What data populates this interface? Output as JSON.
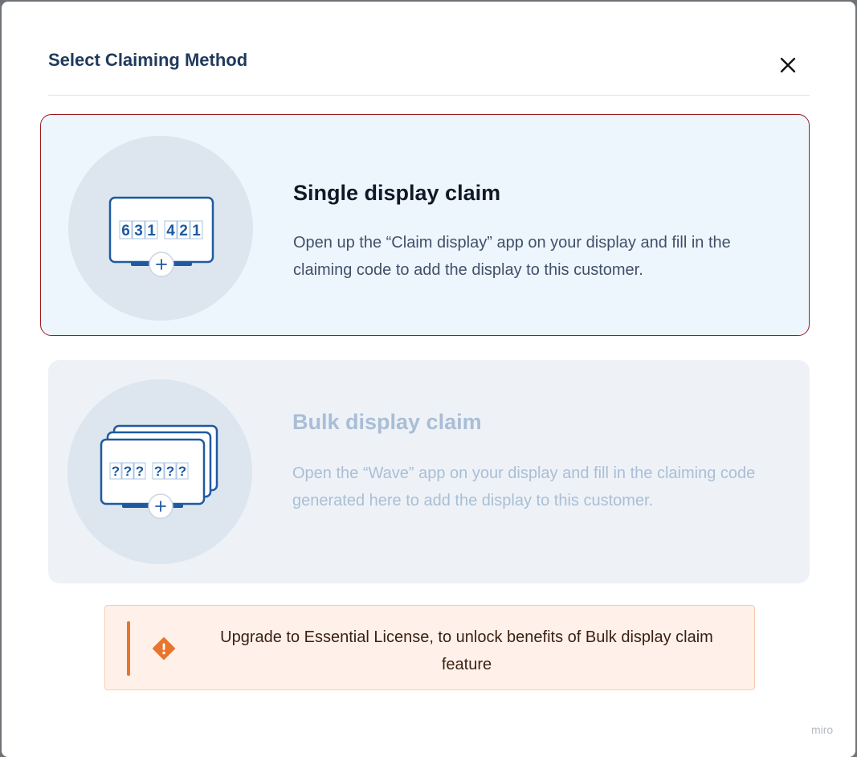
{
  "modal": {
    "title": "Select Claiming Method",
    "close_icon": "close-icon"
  },
  "options": {
    "single": {
      "title": "Single display claim",
      "description": "Open up the “Claim display” app on your display and fill in the claiming code to add the display to this customer.",
      "code_digits": [
        "6",
        "3",
        "1",
        "4",
        "2",
        "1"
      ],
      "icon": "display-claim-icon",
      "selected": true
    },
    "bulk": {
      "title": "Bulk display claim",
      "description": "Open the “Wave” app on your display and fill in the claiming code generated here to add the display to this customer.",
      "code_digits": [
        "?",
        "?",
        "?",
        "?",
        "?",
        "?"
      ],
      "icon": "bulk-display-claim-icon",
      "disabled": true
    }
  },
  "notice": {
    "text": "Upgrade to Essential License, to unlock benefits of Bulk display claim feature",
    "icon": "warning-diamond-icon"
  },
  "watermark": "miro",
  "colors": {
    "selected_border": "#9b1c1f",
    "accent_orange": "#e8752e",
    "title": "#203a5c",
    "display_blue": "#1e5aa0"
  }
}
